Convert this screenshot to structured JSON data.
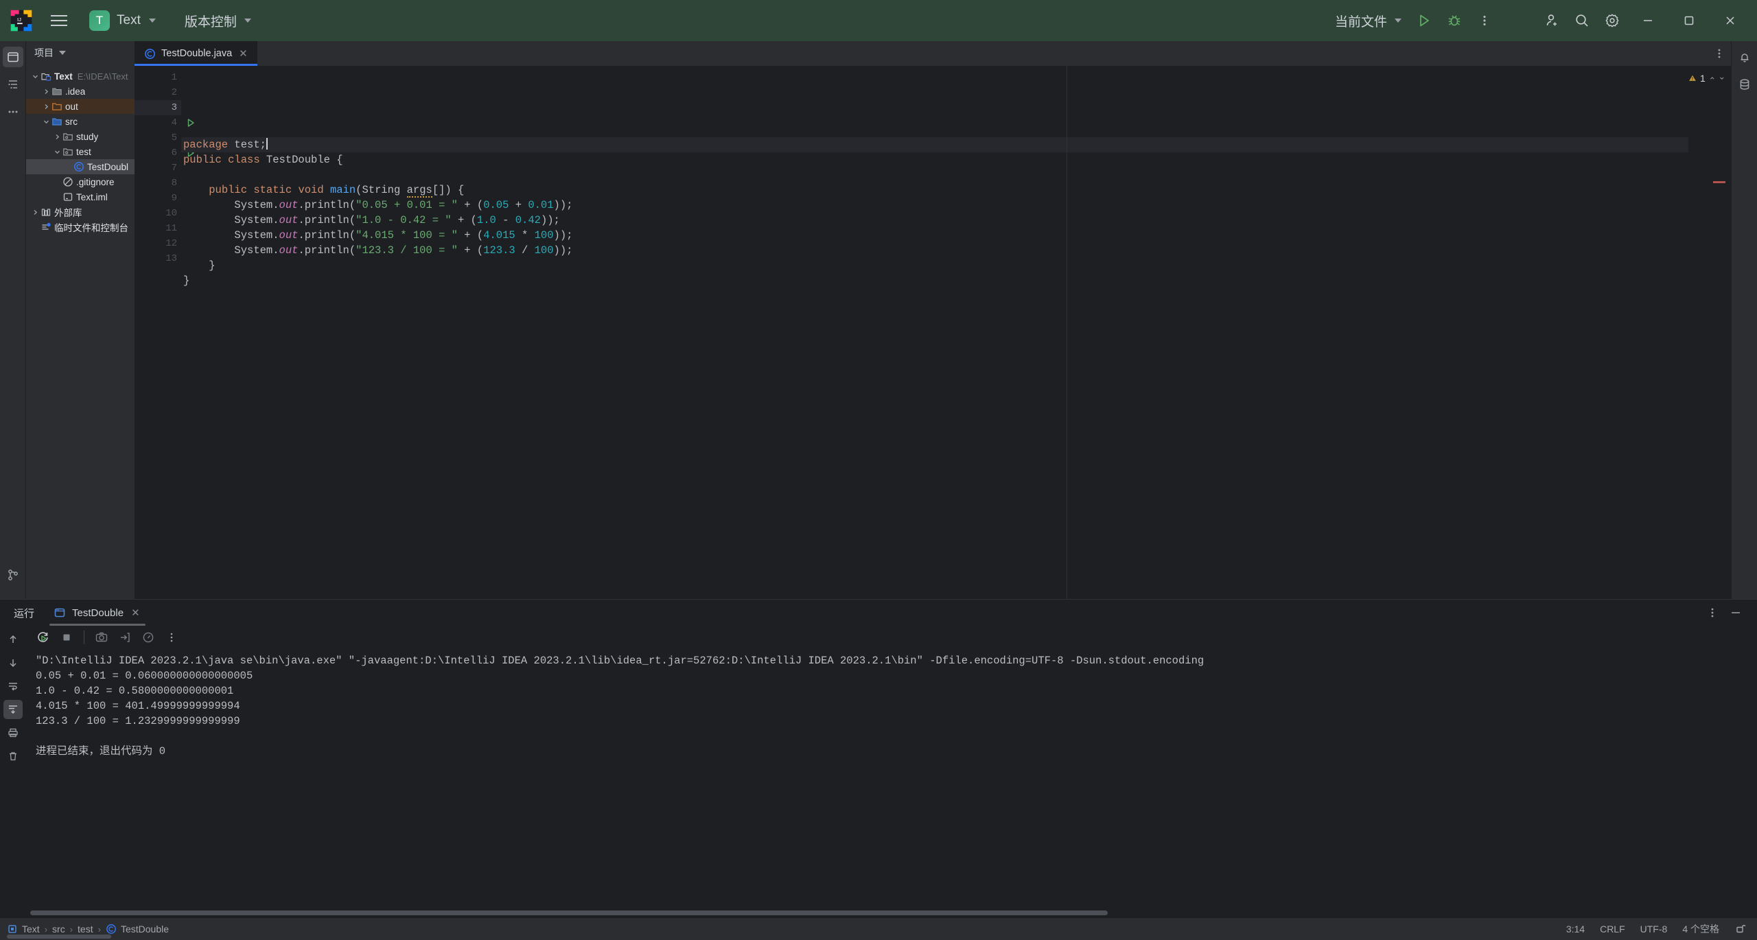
{
  "titlebar": {
    "menu_icon": "hamburger-icon",
    "project_badge": "T",
    "project_name": "Text",
    "vcs_label": "版本控制",
    "run_config": "当前文件",
    "run_icon": "run-icon",
    "debug_icon": "debug-icon",
    "more_icon": "more-vertical-icon",
    "share_icon": "add-user-icon",
    "search_icon": "search-icon",
    "settings_icon": "gear-icon",
    "minimize": "−",
    "maximize": "❐",
    "close": "✕"
  },
  "left_rail": [
    {
      "name": "project-tool-icon",
      "glyph": "folder"
    },
    {
      "name": "structure-tool-icon",
      "glyph": "structure"
    },
    {
      "name": "more-tool-windows-icon",
      "glyph": "dots"
    }
  ],
  "right_rail": [
    {
      "name": "notifications-icon",
      "glyph": "bell"
    },
    {
      "name": "database-icon",
      "glyph": "db"
    }
  ],
  "bottom_rail": [
    {
      "name": "commit-icon",
      "glyph": "git"
    }
  ],
  "project": {
    "header": "项目",
    "tree": [
      {
        "label": "Text",
        "path": "E:\\IDEA\\Text",
        "indent": 0,
        "arrow": "down",
        "icon": "project-folder-icon",
        "state": "normal"
      },
      {
        "label": ".idea",
        "path": "",
        "indent": 1,
        "arrow": "right",
        "icon": "folder-icon",
        "state": "normal"
      },
      {
        "label": "out",
        "path": "",
        "indent": 1,
        "arrow": "right",
        "icon": "excluded-folder-icon",
        "state": "selected-inactive"
      },
      {
        "label": "src",
        "path": "",
        "indent": 1,
        "arrow": "down",
        "icon": "source-folder-icon",
        "state": "normal"
      },
      {
        "label": "study",
        "path": "",
        "indent": 2,
        "arrow": "right",
        "icon": "package-icon",
        "state": "normal"
      },
      {
        "label": "test",
        "path": "",
        "indent": 2,
        "arrow": "down",
        "icon": "package-icon",
        "state": "normal"
      },
      {
        "label": "TestDoubl",
        "path": "",
        "indent": 3,
        "arrow": "none",
        "icon": "java-class-icon",
        "state": "selected"
      },
      {
        "label": ".gitignore",
        "path": "",
        "indent": 2,
        "arrow": "none",
        "icon": "gitignore-icon",
        "state": "normal"
      },
      {
        "label": "Text.iml",
        "path": "",
        "indent": 2,
        "arrow": "none",
        "icon": "iml-icon",
        "state": "normal"
      },
      {
        "label": "外部库",
        "path": "",
        "indent": 0,
        "arrow": "right",
        "icon": "library-icon",
        "state": "normal"
      },
      {
        "label": "临时文件和控制台",
        "path": "",
        "indent": 0,
        "arrow": "none",
        "icon": "scratches-icon",
        "state": "normal"
      }
    ]
  },
  "editor": {
    "tab": {
      "label": "TestDouble.java",
      "icon": "java-class-icon",
      "close": "✕"
    },
    "tab_more_icon": "more-vertical-icon",
    "warning_count": "1",
    "warning_icon": "warning-triangle-icon",
    "line_numbers": [
      "1",
      "2",
      "3",
      "4",
      "5",
      "6",
      "7",
      "8",
      "9",
      "10",
      "11",
      "12",
      "13"
    ],
    "current_line": "3",
    "run_gutter_lines": [
      "4",
      "6"
    ],
    "lines": [
      {
        "n": 1,
        "tokens": []
      },
      {
        "n": 2,
        "tokens": []
      },
      {
        "n": 3,
        "tokens": [
          {
            "t": "package ",
            "c": "kw"
          },
          {
            "t": "test;",
            "c": "pn"
          },
          {
            "t": "",
            "c": "caret"
          }
        ]
      },
      {
        "n": 4,
        "tokens": [
          {
            "t": "public class ",
            "c": "kw"
          },
          {
            "t": "TestDouble {",
            "c": "pn"
          }
        ]
      },
      {
        "n": 5,
        "tokens": []
      },
      {
        "n": 6,
        "tokens": [
          {
            "t": "    ",
            "c": "pn"
          },
          {
            "t": "public static void ",
            "c": "kw"
          },
          {
            "t": "main",
            "c": "fn"
          },
          {
            "t": "(String ",
            "c": "pn"
          },
          {
            "t": "args",
            "c": "warn"
          },
          {
            "t": "[]) {",
            "c": "pn"
          }
        ]
      },
      {
        "n": 7,
        "tokens": [
          {
            "t": "        System.",
            "c": "pn"
          },
          {
            "t": "out",
            "c": "fld"
          },
          {
            "t": ".println(",
            "c": "pn"
          },
          {
            "t": "\"0.05 + 0.01 = \"",
            "c": "str"
          },
          {
            "t": " + (",
            "c": "pn"
          },
          {
            "t": "0.05",
            "c": "num"
          },
          {
            "t": " + ",
            "c": "pn"
          },
          {
            "t": "0.01",
            "c": "num"
          },
          {
            "t": "));",
            "c": "pn"
          }
        ]
      },
      {
        "n": 8,
        "tokens": [
          {
            "t": "        System.",
            "c": "pn"
          },
          {
            "t": "out",
            "c": "fld"
          },
          {
            "t": ".println(",
            "c": "pn"
          },
          {
            "t": "\"1.0 - 0.42 = \"",
            "c": "str"
          },
          {
            "t": " + (",
            "c": "pn"
          },
          {
            "t": "1.0",
            "c": "num"
          },
          {
            "t": " - ",
            "c": "pn"
          },
          {
            "t": "0.42",
            "c": "num"
          },
          {
            "t": "));",
            "c": "pn"
          }
        ]
      },
      {
        "n": 9,
        "tokens": [
          {
            "t": "        System.",
            "c": "pn"
          },
          {
            "t": "out",
            "c": "fld"
          },
          {
            "t": ".println(",
            "c": "pn"
          },
          {
            "t": "\"4.015 * 100 = \"",
            "c": "str"
          },
          {
            "t": " + (",
            "c": "pn"
          },
          {
            "t": "4.015",
            "c": "num"
          },
          {
            "t": " * ",
            "c": "pn"
          },
          {
            "t": "100",
            "c": "num"
          },
          {
            "t": "));",
            "c": "pn"
          }
        ]
      },
      {
        "n": 10,
        "tokens": [
          {
            "t": "        System.",
            "c": "pn"
          },
          {
            "t": "out",
            "c": "fld"
          },
          {
            "t": ".println(",
            "c": "pn"
          },
          {
            "t": "\"123.3 / 100 = \"",
            "c": "str"
          },
          {
            "t": " + (",
            "c": "pn"
          },
          {
            "t": "123.3",
            "c": "num"
          },
          {
            "t": " / ",
            "c": "pn"
          },
          {
            "t": "100",
            "c": "num"
          },
          {
            "t": "));",
            "c": "pn"
          }
        ]
      },
      {
        "n": 11,
        "tokens": [
          {
            "t": "    }",
            "c": "pn"
          }
        ]
      },
      {
        "n": 12,
        "tokens": [
          {
            "t": "}",
            "c": "pn"
          }
        ]
      },
      {
        "n": 13,
        "tokens": []
      }
    ]
  },
  "run_window": {
    "title": "运行",
    "tab_label": "TestDouble",
    "tab_icon": "console-icon",
    "tab_close": "✕",
    "more_icon": "more-vertical-icon",
    "minimize_icon": "minimize-icon",
    "toolbar": [
      {
        "name": "rerun-button",
        "glyph": "rerun"
      },
      {
        "name": "stop-button",
        "glyph": "stop"
      },
      {
        "name": "screenshot-button",
        "glyph": "camera"
      },
      {
        "name": "export-button",
        "glyph": "export"
      },
      {
        "name": "profiler-button",
        "glyph": "gauge"
      },
      {
        "name": "more-button",
        "glyph": "dots"
      }
    ],
    "side_toolbar": [
      {
        "name": "up-button",
        "glyph": "up"
      },
      {
        "name": "down-button",
        "glyph": "down"
      },
      {
        "name": "soft-wrap-button",
        "glyph": "wrap"
      },
      {
        "name": "scroll-end-button",
        "glyph": "scrollend"
      },
      {
        "name": "print-button",
        "glyph": "print"
      },
      {
        "name": "clear-all-button",
        "glyph": "trash"
      }
    ],
    "output": [
      "\"D:\\IntelliJ IDEA 2023.2.1\\java se\\bin\\java.exe\" \"-javaagent:D:\\IntelliJ IDEA 2023.2.1\\lib\\idea_rt.jar=52762:D:\\IntelliJ IDEA 2023.2.1\\bin\" -Dfile.encoding=UTF-8 -Dsun.stdout.encoding",
      "0.05 + 0.01 = 0.060000000000000005",
      "1.0 - 0.42 = 0.5800000000000001",
      "4.015 * 100 = 401.49999999999994",
      "123.3 / 100 = 1.2329999999999999",
      "",
      "进程已结束，退出代码为 0"
    ]
  },
  "statusbar": {
    "breadcrumbs": [
      {
        "label": "Text",
        "icon": "module-icon"
      },
      {
        "label": "src",
        "icon": ""
      },
      {
        "label": "test",
        "icon": ""
      },
      {
        "label": "TestDouble",
        "icon": "java-class-icon"
      }
    ],
    "separator": "›",
    "caret_position": "3:14",
    "line_separator": "CRLF",
    "encoding": "UTF-8",
    "indent": "4 个空格",
    "lock_icon": "unlock-icon"
  },
  "colors": {
    "titlebar_bg": "#2f4538",
    "accent_blue": "#3574f0",
    "keyword": "#cf8e6d",
    "string": "#6aab73",
    "number": "#2aacb8",
    "function": "#56a8f5",
    "field": "#c77dbb",
    "warning": "#cc9a39",
    "panel_bg": "#2b2d30",
    "editor_bg": "#1e1f22"
  }
}
